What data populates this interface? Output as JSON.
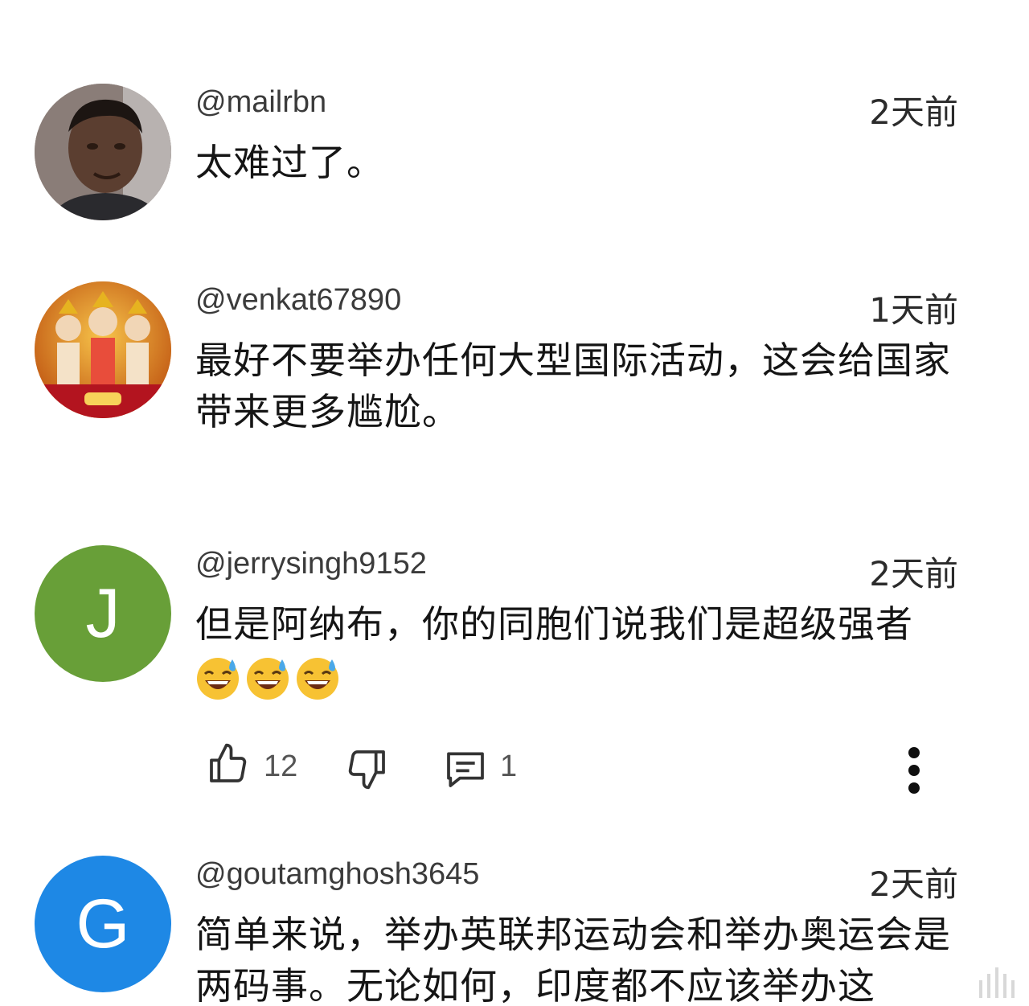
{
  "comments": [
    {
      "handle": "@mailrbn",
      "time": "2天前",
      "text": "太难过了。",
      "avatar": {
        "type": "photo",
        "bg": "#5a4a44"
      }
    },
    {
      "handle": "@venkat67890",
      "time": "1天前",
      "text": "最好不要举办任何大型国际活动，这会给国家带来更多尴尬。",
      "avatar": {
        "type": "photo",
        "bg": "#c8741f"
      }
    },
    {
      "handle": "@jerrysingh9152",
      "time": "2天前",
      "text": "但是阿纳布，你的同胞们说我们是超级强者",
      "emojis": [
        "sweat-smile-emoji",
        "sweat-smile-emoji",
        "sweat-smile-emoji"
      ],
      "avatar": {
        "type": "letter",
        "letter": "J",
        "bg": "#689f38"
      },
      "actions": {
        "likes": "12",
        "replies": "1"
      }
    },
    {
      "handle": "@goutamghosh3645",
      "time": "2天前",
      "text": "简单来说，举办英联邦运动会和举办奥运会是两码事。无论如何，印度都不应该举办这",
      "avatar": {
        "type": "letter",
        "letter": "G",
        "bg": "#1e88e5"
      }
    }
  ],
  "icons": {
    "like": "thumbs-up-icon",
    "dislike": "thumbs-down-icon",
    "reply": "comment-icon",
    "more": "more-vert-icon"
  }
}
